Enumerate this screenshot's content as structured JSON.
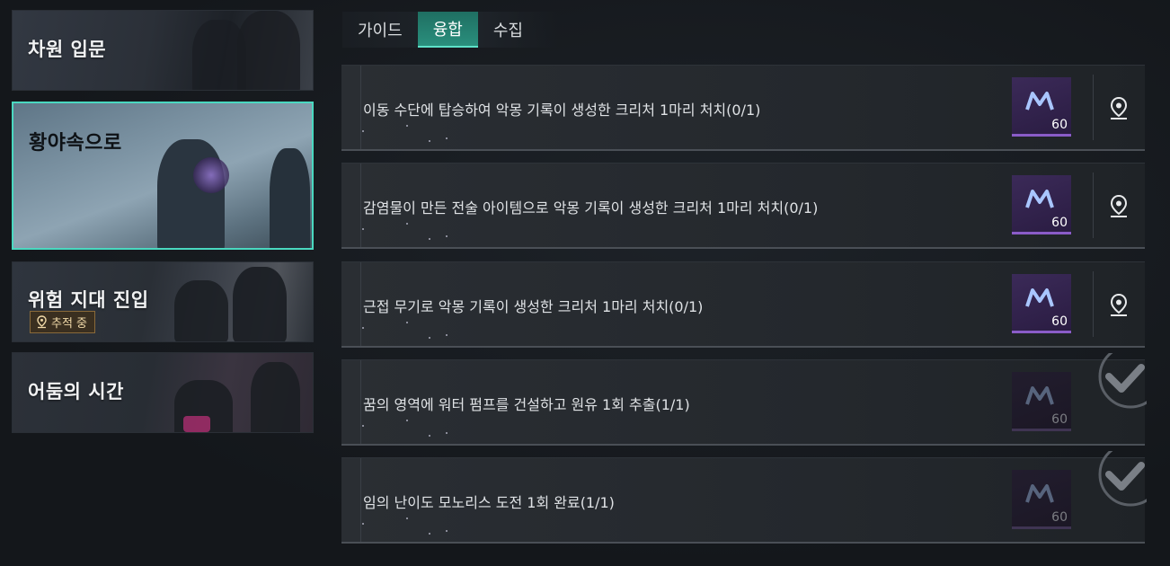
{
  "sidebar": {
    "chapters": [
      {
        "title": "차원 입문"
      },
      {
        "title": "황야속으로"
      },
      {
        "title": "위험 지대 진입",
        "badge": "추적 중"
      },
      {
        "title": "어둠의 시간"
      }
    ]
  },
  "tabs": [
    {
      "label": "가이드"
    },
    {
      "label": "융합"
    },
    {
      "label": "수집"
    }
  ],
  "active_tab": "융합",
  "missions": [
    {
      "text": "이동 수단에 탑승하여 악몽 기록이 생성한 크리처 1마리 처치(0/1)",
      "reward_qty": "60",
      "completed": false
    },
    {
      "text": "감염물이 만든 전술 아이템으로 악몽 기록이 생성한 크리처 1마리 처치(0/1)",
      "reward_qty": "60",
      "completed": false
    },
    {
      "text": "근접 무기로 악몽 기록이 생성한 크리처 1마리 처치(0/1)",
      "reward_qty": "60",
      "completed": false
    },
    {
      "text": "꿈의 영역에 워터 펌프를 건설하고 원유 1회 추출(1/1)",
      "reward_qty": "60",
      "completed": true
    },
    {
      "text": "임의 난이도 모노리스 도전 1회 완료(1/1)",
      "reward_qty": "60",
      "completed": true
    }
  ],
  "colors": {
    "accent": "#4ad8c0",
    "reward_purple": "#8a5cc8",
    "badge_gold": "#8a6a3a"
  },
  "icons": {
    "reward": "monolith-currency-icon",
    "locate": "map-pin-icon",
    "complete": "checkmark-icon"
  }
}
